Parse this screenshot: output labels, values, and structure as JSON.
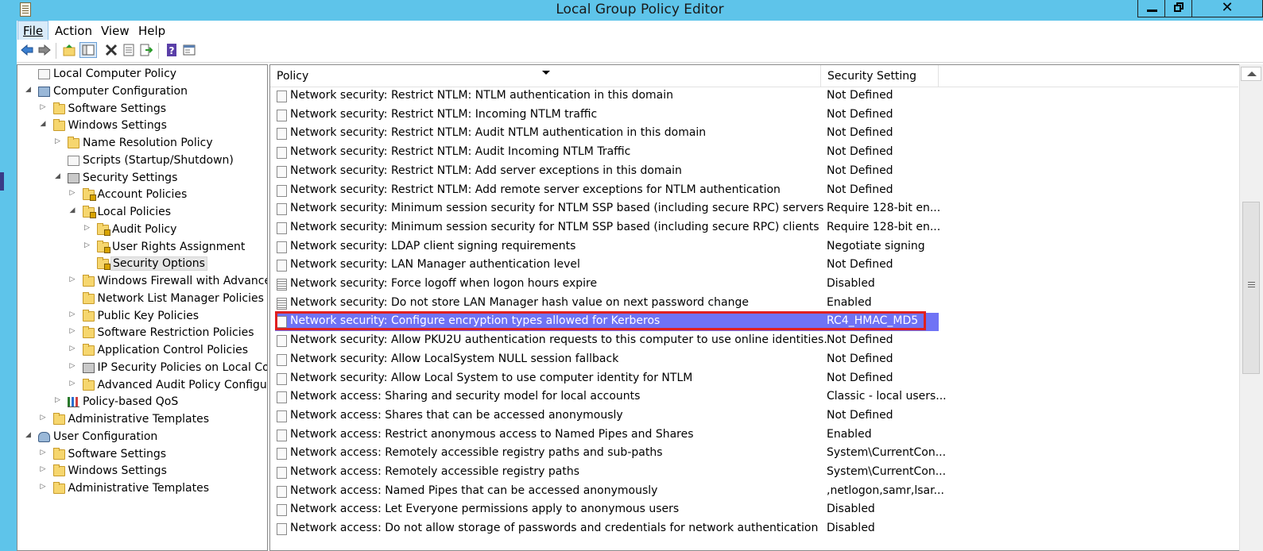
{
  "window": {
    "title": "Local Group Policy Editor",
    "controls": {
      "minimize": "minimize",
      "maximize": "restore",
      "close": "✕"
    }
  },
  "menu": {
    "file": "File",
    "action": "Action",
    "view": "View",
    "help": "Help"
  },
  "toolbar": {
    "icons": [
      "back-icon",
      "forward-icon",
      "up-folder-icon",
      "show-hide-tree-icon",
      "delete-icon",
      "properties-icon",
      "export-list-icon",
      "help-icon",
      "console-icon"
    ]
  },
  "tree": [
    {
      "label": "Local Computer Policy",
      "icon": "policy-doc-icon"
    },
    {
      "label": "Computer Configuration",
      "icon": "computer-icon"
    },
    {
      "label": "Software Settings",
      "icon": "folder-icon"
    },
    {
      "label": "Windows Settings",
      "icon": "folder-icon"
    },
    {
      "label": "Name Resolution Policy",
      "icon": "folder-icon"
    },
    {
      "label": "Scripts (Startup/Shutdown)",
      "icon": "script-doc-icon"
    },
    {
      "label": "Security Settings",
      "icon": "security-settings-icon"
    },
    {
      "label": "Account Policies",
      "icon": "locked-folder-icon"
    },
    {
      "label": "Local Policies",
      "icon": "locked-folder-icon"
    },
    {
      "label": "Audit Policy",
      "icon": "locked-folder-icon"
    },
    {
      "label": "User Rights Assignment",
      "icon": "locked-folder-icon"
    },
    {
      "label": "Security Options",
      "icon": "locked-folder-icon"
    },
    {
      "label": "Windows Firewall with Advanced",
      "icon": "folder-icon"
    },
    {
      "label": "Network List Manager Policies",
      "icon": "folder-icon"
    },
    {
      "label": "Public Key Policies",
      "icon": "folder-icon"
    },
    {
      "label": "Software Restriction Policies",
      "icon": "folder-icon"
    },
    {
      "label": "Application Control Policies",
      "icon": "folder-icon"
    },
    {
      "label": "IP Security Policies on Local Com",
      "icon": "ip-security-icon"
    },
    {
      "label": "Advanced Audit Policy Configura",
      "icon": "folder-icon"
    },
    {
      "label": "Policy-based QoS",
      "icon": "chart-icon"
    },
    {
      "label": "Administrative Templates",
      "icon": "folder-icon"
    },
    {
      "label": "User Configuration",
      "icon": "users-icon"
    },
    {
      "label": "Software Settings",
      "icon": "folder-icon"
    },
    {
      "label": "Windows Settings",
      "icon": "folder-icon"
    },
    {
      "label": "Administrative Templates",
      "icon": "folder-icon"
    }
  ],
  "list": {
    "columns": {
      "policy": "Policy",
      "setting": "Security Setting"
    },
    "rows": [
      {
        "policy": "Network security: Restrict NTLM: NTLM authentication in this domain",
        "setting": "Not Defined"
      },
      {
        "policy": "Network security: Restrict NTLM: Incoming NTLM traffic",
        "setting": "Not Defined"
      },
      {
        "policy": "Network security: Restrict NTLM: Audit NTLM authentication in this domain",
        "setting": "Not Defined"
      },
      {
        "policy": "Network security: Restrict NTLM: Audit Incoming NTLM Traffic",
        "setting": "Not Defined"
      },
      {
        "policy": "Network security: Restrict NTLM: Add server exceptions in this domain",
        "setting": "Not Defined"
      },
      {
        "policy": "Network security: Restrict NTLM: Add remote server exceptions for NTLM authentication",
        "setting": "Not Defined"
      },
      {
        "policy": "Network security: Minimum session security for NTLM SSP based (including secure RPC) servers",
        "setting": "Require 128-bit en..."
      },
      {
        "policy": "Network security: Minimum session security for NTLM SSP based (including secure RPC) clients",
        "setting": "Require 128-bit en..."
      },
      {
        "policy": "Network security: LDAP client signing requirements",
        "setting": "Negotiate signing"
      },
      {
        "policy": "Network security: LAN Manager authentication level",
        "setting": "Not Defined"
      },
      {
        "policy": "Network security: Force logoff when logon hours expire",
        "setting": "Disabled"
      },
      {
        "policy": "Network security: Do not store LAN Manager hash value on next password change",
        "setting": "Enabled"
      },
      {
        "policy": "Network security: Configure encryption types allowed for Kerberos",
        "setting": "RC4_HMAC_MD5"
      },
      {
        "policy": "Network security: Allow PKU2U authentication requests to this computer to use online identities.",
        "setting": "Not Defined"
      },
      {
        "policy": "Network security: Allow LocalSystem NULL session fallback",
        "setting": "Not Defined"
      },
      {
        "policy": "Network security: Allow Local System to use computer identity for NTLM",
        "setting": "Not Defined"
      },
      {
        "policy": "Network access: Sharing and security model for local accounts",
        "setting": "Classic - local users..."
      },
      {
        "policy": "Network access: Shares that can be accessed anonymously",
        "setting": "Not Defined"
      },
      {
        "policy": "Network access: Restrict anonymous access to Named Pipes and Shares",
        "setting": "Enabled"
      },
      {
        "policy": "Network access: Remotely accessible registry paths and sub-paths",
        "setting": "System\\CurrentCon..."
      },
      {
        "policy": "Network access: Remotely accessible registry paths",
        "setting": "System\\CurrentCon..."
      },
      {
        "policy": "Network access: Named Pipes that can be accessed anonymously",
        "setting": ",netlogon,samr,lsar..."
      },
      {
        "policy": "Network access: Let Everyone permissions apply to anonymous users",
        "setting": "Disabled"
      },
      {
        "policy": "Network access: Do not allow storage of passwords and credentials for network authentication",
        "setting": "Disabled"
      }
    ]
  },
  "colors": {
    "titlebar": "#5ec4ea",
    "selection": "#6f73f5",
    "highlight_box": "#e02020"
  }
}
